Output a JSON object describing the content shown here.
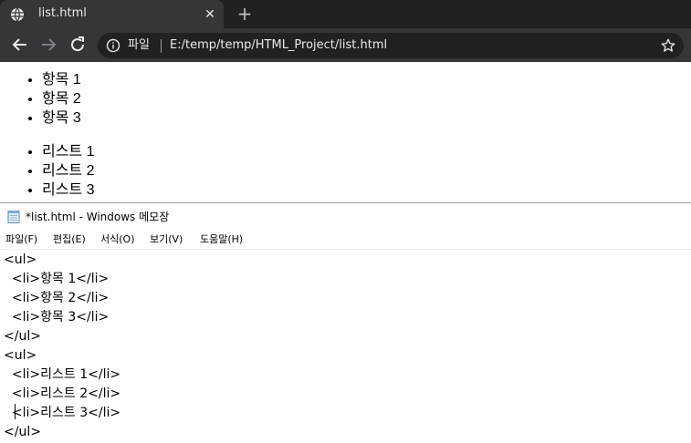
{
  "browser": {
    "tab": {
      "title": "list.html",
      "close": "✕"
    },
    "new_tab": "+",
    "omnibox": {
      "chip": "파일",
      "url": "E:/temp/temp/HTML_Project/list.html"
    }
  },
  "page": {
    "list1": [
      "항목 1",
      "항목 2",
      "항목 3"
    ],
    "list2": [
      "리스트 1",
      "리스트 2",
      "리스트 3"
    ]
  },
  "notepad": {
    "title": "*list.html - Windows 메모장",
    "menu": [
      "파일(F)",
      "편집(E)",
      "서식(O)",
      "보기(V)",
      "도움말(H)"
    ],
    "lines": [
      "<ul>",
      "  <li>항목 1</li>",
      "  <li>항목 2</li>",
      "  <li>항목 3</li>",
      "</ul>",
      "<ul>",
      "  <li>리스트 1</li>",
      "  <li>리스트 2</li>",
      "  <li>리스트 3</li>",
      "</ul>"
    ]
  },
  "colors": {
    "chrome_dark": "#202124",
    "chrome_tab": "#35363a",
    "chrome_text": "#e8eaed"
  }
}
